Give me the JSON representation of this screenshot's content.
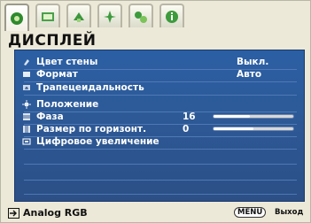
{
  "tabs": [
    {
      "name": "display-tab",
      "active": true
    },
    {
      "name": "picture-tab",
      "active": false
    },
    {
      "name": "source-tab",
      "active": false
    },
    {
      "name": "system-setup-tab",
      "active": false
    },
    {
      "name": "advanced-setup-tab",
      "active": false
    },
    {
      "name": "information-tab",
      "active": false
    }
  ],
  "title": "ДИСПЛЕЙ",
  "menu": {
    "wall_color": {
      "label": "Цвет стены",
      "value": "Выкл."
    },
    "aspect": {
      "label": "Формат",
      "value": "Авто"
    },
    "keystone": {
      "label": "Трапецеидальность"
    },
    "position": {
      "label": "Положение"
    },
    "phase": {
      "label": "Фаза",
      "value": "16",
      "level": 0.45
    },
    "hsize": {
      "label": "Размер по горизонт.",
      "value": "0",
      "level": 0.5
    },
    "zoom": {
      "label": "Цифровое увеличение"
    }
  },
  "footer": {
    "source": "Analog RGB",
    "menu_key": "MENU",
    "exit_label": "Выход"
  },
  "colors": {
    "panel": "#2c5a9b",
    "accent": "#ffffff"
  }
}
